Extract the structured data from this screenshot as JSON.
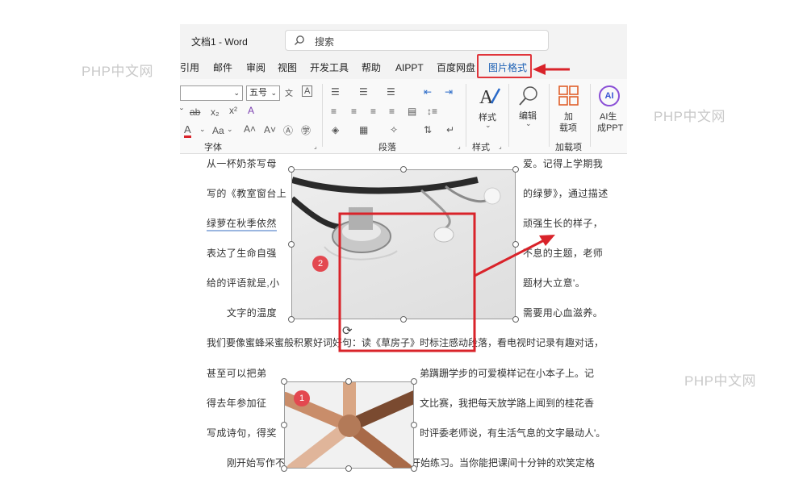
{
  "watermarks": [
    "PHP中文网",
    "PHP中文网",
    "PHP中文网",
    "PHP中文网"
  ],
  "app_title": "文档1 - Word",
  "search": {
    "label": "搜索"
  },
  "tabs": [
    "引用",
    "邮件",
    "审阅",
    "视图",
    "开发工具",
    "帮助",
    "AIPPT",
    "百度网盘",
    "图片格式"
  ],
  "ribbon": {
    "font_size": "五号",
    "group_labels": {
      "font": "字体",
      "paragraph": "段落",
      "styles": "样式",
      "addins": "加载项"
    },
    "styles_label": "样式",
    "edit_label": "编辑",
    "addins_label_1": "加",
    "addins_label_2": "载项",
    "ai_label_1": "AI生",
    "ai_label_2": "成PPT",
    "ai_icon_text": "AI"
  },
  "document": {
    "lines": [
      "从一杯奶茶写母",
      "写的《教室窗台上",
      "绿萝在秋季依然",
      "表达了生命自强",
      "给的评语就是,小",
      "文字的温度",
      "我们要像蜜蜂采蜜般积累好词好句：读《草房子》时标注感动段落，看电视时记录有趣对话，",
      "甚至可以把弟",
      "得去年参加征",
      "写成诗句，得奖",
      "刚开始写作不必苛求完美，从坚持观察日记开始练习。当你能把课间十分钟的欢笑定格"
    ],
    "right_lines": [
      "爱。记得上学期我",
      "的绿萝》，通过描述",
      "顽强生长的样子，",
      "不息的主题，老师",
      "题材大立意'。",
      "需要用心血滋养。",
      "弟蹒跚学步的可爱模样记在小本子上。记",
      "文比赛，我把每天放学路上闻到的桂花香",
      "时评委老师说，有生活气息的文字最动人'。"
    ],
    "badges": [
      "2",
      "1"
    ]
  },
  "colors": {
    "accent": "#1a5fb4",
    "annotation_red": "#d9232a",
    "badge": "#e34850"
  }
}
